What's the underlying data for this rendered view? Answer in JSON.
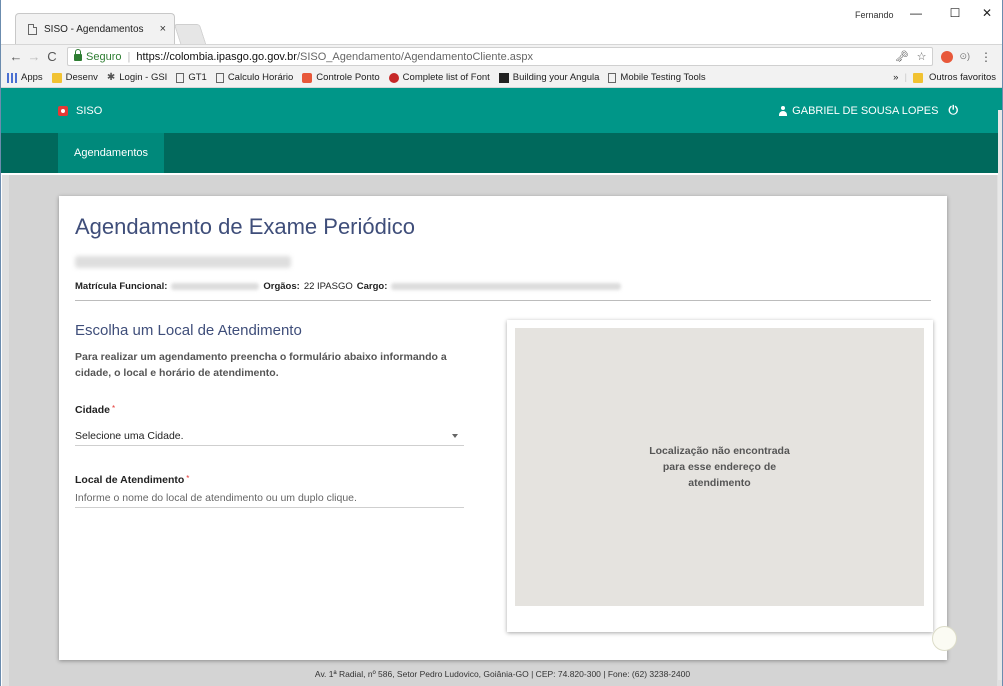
{
  "browser": {
    "tab_title": "SISO - Agendamentos",
    "tab_close": "×",
    "window_user": "Fernando",
    "window_controls": {
      "minimize": "—",
      "maximize": "☐",
      "close": "✕"
    },
    "nav": {
      "back": "←",
      "forward": "→",
      "reload": "C"
    },
    "address": {
      "secure_label": "Seguro",
      "separator": "|",
      "url_host": "https://colombia.ipasgo.go.gov.br",
      "url_path": "/SISO_Agendamento/AgendamentoCliente.aspx",
      "tail": "⊙)"
    },
    "bookmarks": [
      {
        "label": "Apps",
        "icon": "apps-icon"
      },
      {
        "label": "Desenv",
        "icon": "folder-icon"
      },
      {
        "label": "Login - GSI",
        "icon": "star-icon"
      },
      {
        "label": "GT1",
        "icon": "page-icon"
      },
      {
        "label": "Calculo Horário",
        "icon": "page-icon"
      },
      {
        "label": "Controle Ponto",
        "icon": "red-square-icon"
      },
      {
        "label": "Complete list of Font",
        "icon": "red-dot-icon"
      },
      {
        "label": "Building your Angula",
        "icon": "dark-square-icon"
      },
      {
        "label": "Mobile Testing Tools",
        "icon": "page-icon"
      }
    ],
    "bookmarks_more": "»",
    "other_bookmarks": "Outros favoritos"
  },
  "app": {
    "brand": "SISO",
    "user_name": "GABRIEL DE SOUSA LOPES",
    "nav_items": [
      "Agendamentos"
    ]
  },
  "page": {
    "title": "Agendamento de Exame Periódico",
    "matricula_label": "Matrícula Funcional:",
    "orgaos_label": "Orgãos:",
    "orgaos_value": "22 IPASGO",
    "cargo_label": "Cargo:",
    "section_title": "Escolha um Local de Atendimento",
    "section_desc": "Para realizar um agendamento preencha o formulário abaixo informando a cidade, o local e horário de atendimento.",
    "cidade_label": "Cidade",
    "required_mark": "*",
    "cidade_value": "Selecione uma Cidade.",
    "local_label": "Local de Atendimento",
    "local_placeholder": "Informe o nome do local de atendimento ou um duplo clique.",
    "map_message": "Localização não encontrada para esse endereço de atendimento"
  },
  "footer": {
    "address": "Av. 1ª Radial, nº 586, Setor Pedro Ludovico, Goiânia-GO | CEP: 74.820-300 | Fone: (62) 3238-2400"
  },
  "colors": {
    "header": "#009688",
    "nav": "#00695c",
    "title": "#3f4e7a",
    "required": "#e53935"
  }
}
